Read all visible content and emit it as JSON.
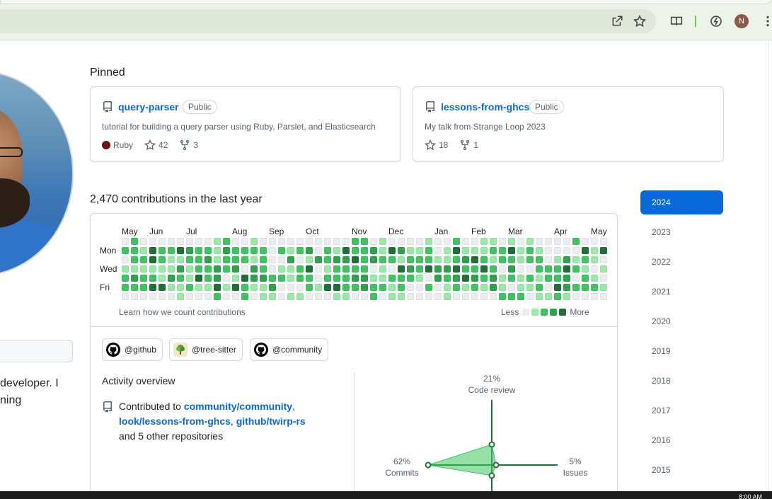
{
  "pinned": {
    "title": "Pinned",
    "cards": [
      {
        "name": "query-parser",
        "visibility": "Public",
        "description": "tutorial for building a query parser using Ruby, Parslet, and Elasticsearch",
        "language": "Ruby",
        "language_color": "#701516",
        "stars": "42",
        "forks": "3"
      },
      {
        "name": "lessons-from-ghcs",
        "visibility": "Public",
        "description": "My talk from Strange Loop 2023",
        "stars": "18",
        "forks": "1"
      }
    ]
  },
  "contributions": {
    "title": "2,470 contributions in the last year",
    "months": [
      "May",
      "Jun",
      "Jul",
      "Aug",
      "Sep",
      "Oct",
      "Nov",
      "Dec",
      "Jan",
      "Feb",
      "Mar",
      "Apr",
      "May"
    ],
    "day_labels": [
      "Mon",
      "Wed",
      "Fri"
    ],
    "learn_link": "Learn how we count contributions",
    "legend_less": "Less",
    "legend_more": "More",
    "level_colors": [
      "#ebedf0",
      "#9be9a8",
      "#40c463",
      "#30a14e",
      "#216e39"
    ]
  },
  "orgs": [
    "@github",
    "@tree-sitter",
    "@community"
  ],
  "activity": {
    "title": "Activity overview",
    "contributed_prefix": "Contributed to",
    "repo1": "community/community",
    "repo2": "look/lessons-from-ghcs",
    "repo3": "github/twirp-rs",
    "others": "and 5 other repositories",
    "radar": {
      "code_review_pct": "21%",
      "code_review": "Code review",
      "commits_pct": "62%",
      "commits": "Commits",
      "issues_pct": "5%",
      "issues": "Issues"
    }
  },
  "years": [
    "2024",
    "2023",
    "2022",
    "2021",
    "2020",
    "2019",
    "2018",
    "2017",
    "2016",
    "2015"
  ],
  "profile": {
    "bio_line1": "developer. I",
    "bio_line2": "ning"
  },
  "chrome": {
    "avatar_letter": "N",
    "clock": "8:00 AM"
  }
}
